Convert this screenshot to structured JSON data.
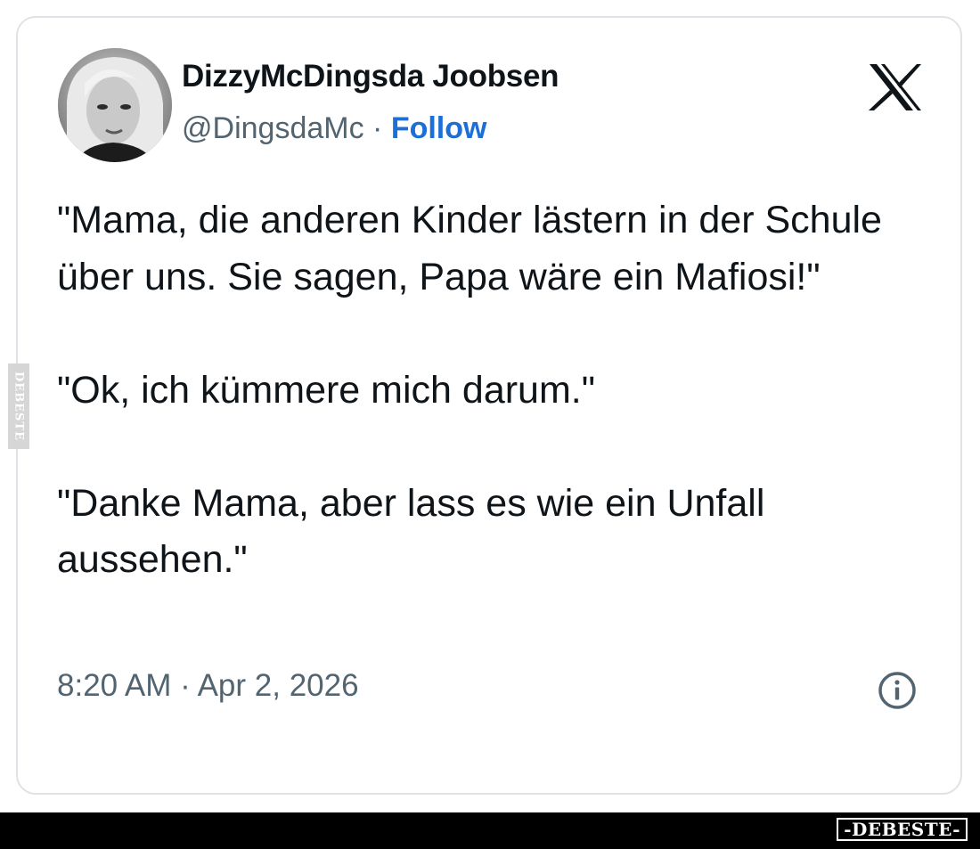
{
  "tweet": {
    "display_name": "DizzyMcDingsda Joobsen",
    "handle": "@DingsdaMc",
    "separator": " · ",
    "follow_label": "Follow",
    "paragraphs": [
      "\"Mama, die anderen Kinder lästern in der Schule über uns. Sie sagen, Papa wäre ein Mafiosi!\"",
      "\"Ok, ich kümmere mich darum.\"",
      "\"Danke Mama, aber lass es wie ein Unfall aussehen.\""
    ],
    "timestamp": "8:20 AM · Apr 2, 2026"
  },
  "icons": {
    "brand": "x-logo-icon",
    "info": "info-icon",
    "avatar": "avatar"
  },
  "watermark": {
    "side": "DEBESTE",
    "bottom": "-DEBESTE-"
  },
  "colors": {
    "text_primary": "#0f1419",
    "text_secondary": "#536471",
    "follow_link": "#1d6fd8",
    "card_border": "#dfe3e7",
    "bottom_bar": "#000000"
  }
}
